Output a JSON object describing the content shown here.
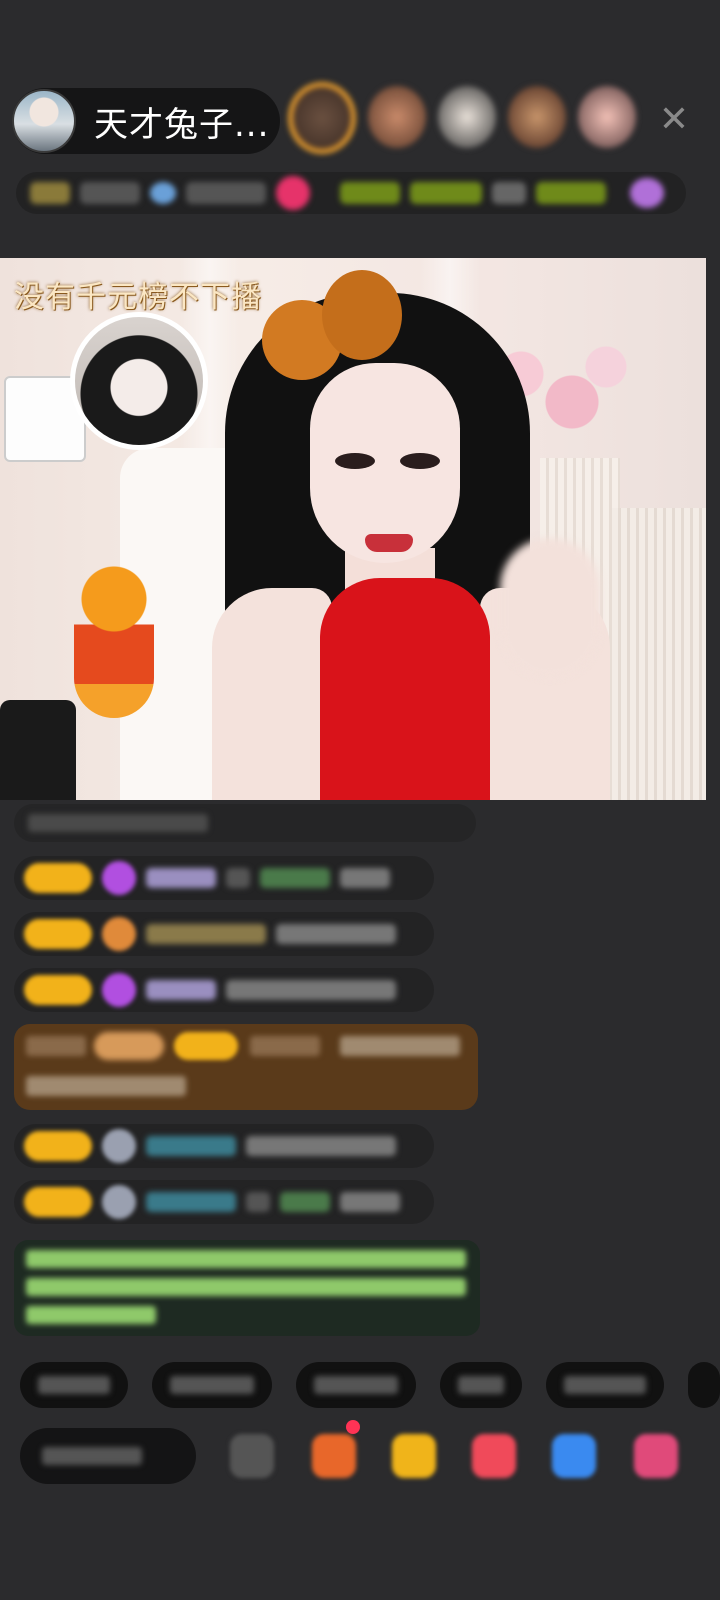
{
  "header": {
    "host_name": "天才兔子..."
  },
  "stream": {
    "title_overlay": "没有千元榜不下播"
  },
  "colors": {
    "background": "#2b2b2d",
    "gold_badge": "#f2b21a",
    "highlight_red": "#ff3355"
  },
  "icons": {
    "close": "close-icon"
  }
}
